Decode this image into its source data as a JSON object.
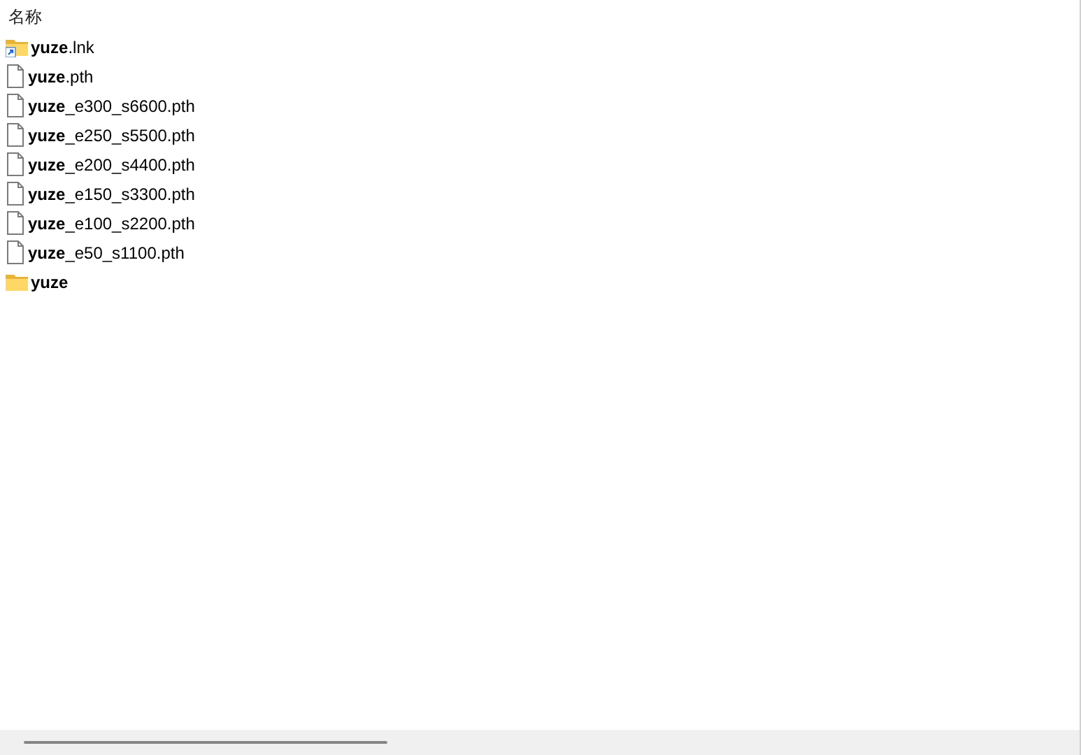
{
  "column_header": "名称",
  "items": [
    {
      "name": "**yuze**.lnk",
      "kind": "shortcut"
    },
    {
      "name": "**yuze**.pth",
      "kind": "file"
    },
    {
      "name": "**yuze**_e300_s6600.pth",
      "kind": "file"
    },
    {
      "name": "**yuze**_e250_s5500.pth",
      "kind": "file"
    },
    {
      "name": "**yuze**_e200_s4400.pth",
      "kind": "file"
    },
    {
      "name": "**yuze**_e150_s3300.pth",
      "kind": "file"
    },
    {
      "name": "**yuze**_e100_s2200.pth",
      "kind": "file"
    },
    {
      "name": "**yuze**_e50_s1100.pth",
      "kind": "file"
    },
    {
      "name": "yuze",
      "kind": "folder"
    }
  ]
}
